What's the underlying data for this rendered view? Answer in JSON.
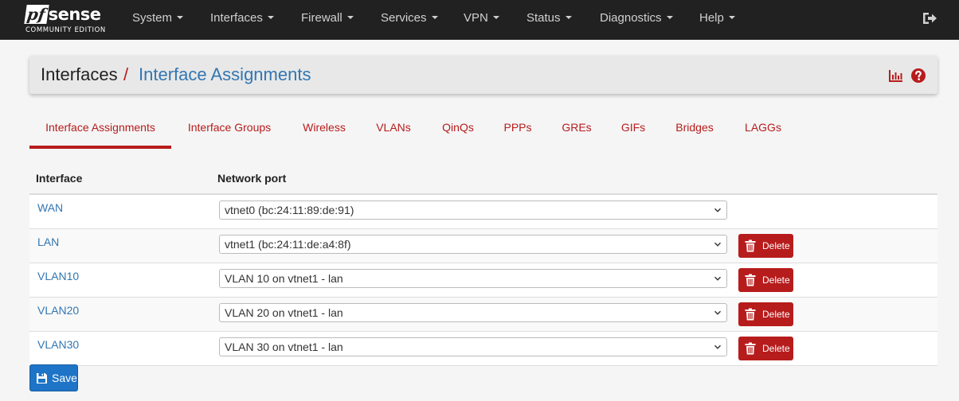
{
  "brand": {
    "logo_pf": "pf",
    "logo_sense": "sense",
    "edition": "COMMUNITY EDITION"
  },
  "nav": {
    "items": [
      {
        "label": "System"
      },
      {
        "label": "Interfaces"
      },
      {
        "label": "Firewall"
      },
      {
        "label": "Services"
      },
      {
        "label": "VPN"
      },
      {
        "label": "Status"
      },
      {
        "label": "Diagnostics"
      },
      {
        "label": "Help"
      }
    ],
    "logout_icon": "sign-out-icon"
  },
  "header": {
    "breadcrumb_root": "Interfaces",
    "separator": "/",
    "breadcrumb_current": "Interface Assignments",
    "icons": [
      "bar-chart-icon",
      "help-circle-icon"
    ]
  },
  "tabs": [
    {
      "label": "Interface Assignments",
      "active": true
    },
    {
      "label": "Interface Groups"
    },
    {
      "label": "Wireless"
    },
    {
      "label": "VLANs"
    },
    {
      "label": "QinQs"
    },
    {
      "label": "PPPs"
    },
    {
      "label": "GREs"
    },
    {
      "label": "GIFs"
    },
    {
      "label": "Bridges"
    },
    {
      "label": "LAGGs"
    }
  ],
  "table": {
    "columns": [
      "Interface",
      "Network port"
    ],
    "rows": [
      {
        "interface": "WAN",
        "port": "vtnet0 (bc:24:11:89:de:91)",
        "deletable": false
      },
      {
        "interface": "LAN",
        "port": "vtnet1 (bc:24:11:de:a4:8f)",
        "deletable": true
      },
      {
        "interface": "VLAN10",
        "port": "VLAN 10 on vtnet1 - lan",
        "deletable": true
      },
      {
        "interface": "VLAN20",
        "port": "VLAN 20 on vtnet1 - lan",
        "deletable": true
      },
      {
        "interface": "VLAN30",
        "port": "VLAN 30 on vtnet1 - lan",
        "deletable": true
      }
    ],
    "delete_label": "Delete"
  },
  "save_label": "Save",
  "colors": {
    "navbar": "#212121",
    "accent_red": "#b71c1c",
    "link_blue": "#3276b1",
    "save_blue": "#1e74c6"
  }
}
